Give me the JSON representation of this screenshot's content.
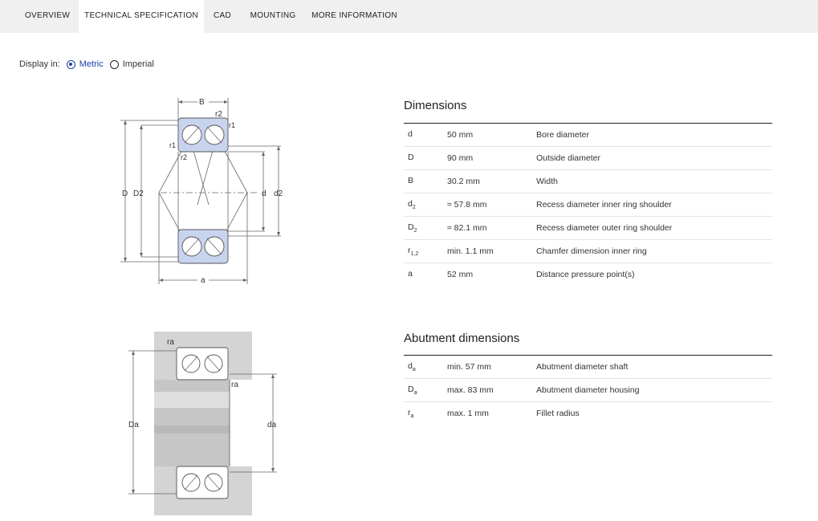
{
  "tabs": [
    {
      "label": "Overview"
    },
    {
      "label": "Technical specification"
    },
    {
      "label": "CAD"
    },
    {
      "label": "Mounting"
    },
    {
      "label": "More information"
    }
  ],
  "display": {
    "label": "Display in:",
    "metric": "Metric",
    "imperial": "Imperial",
    "selected": "Metric"
  },
  "diagram_top": {
    "B": "B",
    "r2_top": "r2",
    "r1_top": "r1",
    "r1_left": "r1",
    "r2_left": "r2",
    "D": "D",
    "D2": "D2",
    "d": "d",
    "d2": "d2",
    "a": "a"
  },
  "diagram_bottom": {
    "ra_top": "ra",
    "ra_mid": "ra",
    "Da": "Da",
    "da": "da"
  },
  "dimensions": {
    "title": "Dimensions",
    "rows": [
      {
        "sym": "d",
        "sub": "",
        "value": "50 mm",
        "desc": "Bore diameter"
      },
      {
        "sym": "D",
        "sub": "",
        "value": "90 mm",
        "desc": "Outside diameter"
      },
      {
        "sym": "B",
        "sub": "",
        "value": "30.2 mm",
        "desc": "Width"
      },
      {
        "sym": "d",
        "sub": "2",
        "value": "≈ 57.8 mm",
        "desc": "Recess diameter inner ring shoulder"
      },
      {
        "sym": "D",
        "sub": "2",
        "value": "≈ 82.1 mm",
        "desc": "Recess diameter outer ring shoulder"
      },
      {
        "sym": "r",
        "sub": "1,2",
        "value": "min. 1.1 mm",
        "desc": "Chamfer dimension inner ring"
      },
      {
        "sym": "a",
        "sub": "",
        "value": "52 mm",
        "desc": "Distance pressure point(s)"
      }
    ]
  },
  "abutment": {
    "title": "Abutment dimensions",
    "rows": [
      {
        "sym": "d",
        "sub": "a",
        "value": "min. 57 mm",
        "desc": "Abutment diameter shaft"
      },
      {
        "sym": "D",
        "sub": "a",
        "value": "max. 83 mm",
        "desc": "Abutment diameter housing"
      },
      {
        "sym": "r",
        "sub": "a",
        "value": "max. 1 mm",
        "desc": "Fillet radius"
      }
    ]
  },
  "colors": {
    "accent": "#1b3ea8",
    "ring_fill": "#c8d3ee",
    "housing_fill": "#d4d4d4",
    "tabbar_bg": "#f0f0f0"
  }
}
